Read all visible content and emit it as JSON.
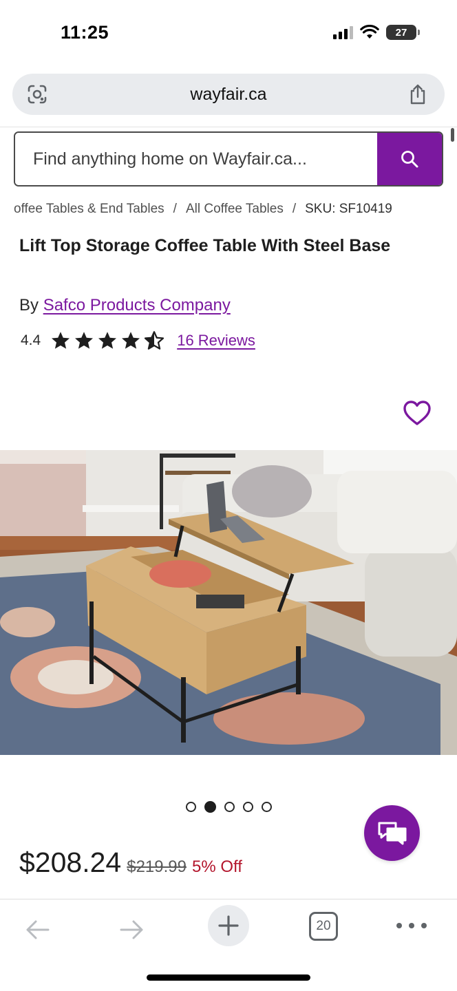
{
  "status_bar": {
    "time": "11:25",
    "battery": "27",
    "icons": [
      "signal-icon",
      "wifi-icon",
      "battery-icon"
    ]
  },
  "browser": {
    "url": "wayfair.ca",
    "icons": [
      "lens-icon",
      "share-icon"
    ]
  },
  "search": {
    "placeholder": "Find anything home on Wayfair.ca...",
    "icon": "search-icon",
    "accent_color": "#7b189f"
  },
  "breadcrumb": {
    "items": [
      "offee Tables & End Tables",
      "All Coffee Tables",
      "SKU: SF10419"
    ],
    "separator": "/"
  },
  "product": {
    "title": "Lift Top Storage Coffee Table With Steel Base",
    "brand_prefix": "By ",
    "brand": "Safco Products Company",
    "rating": "4.4",
    "rating_value": 4.4,
    "rating_max": 5,
    "reviews": "16 Reviews",
    "favorite_icon": "heart-outline-icon",
    "image_alt": "Lift top coffee table in living room with white sofa and patterned rug",
    "carousel": {
      "total": 5,
      "active_index": 1
    },
    "price": "$208.24",
    "original_price": "$219.99",
    "discount": "5% Off",
    "discount_color": "#b3152c"
  },
  "chat": {
    "icon": "chat-bubbles-icon"
  },
  "toolbar": {
    "tab_count": "20",
    "icons": [
      "back-arrow-icon",
      "forward-arrow-icon",
      "plus-icon",
      "tabs-icon",
      "more-icon"
    ]
  }
}
